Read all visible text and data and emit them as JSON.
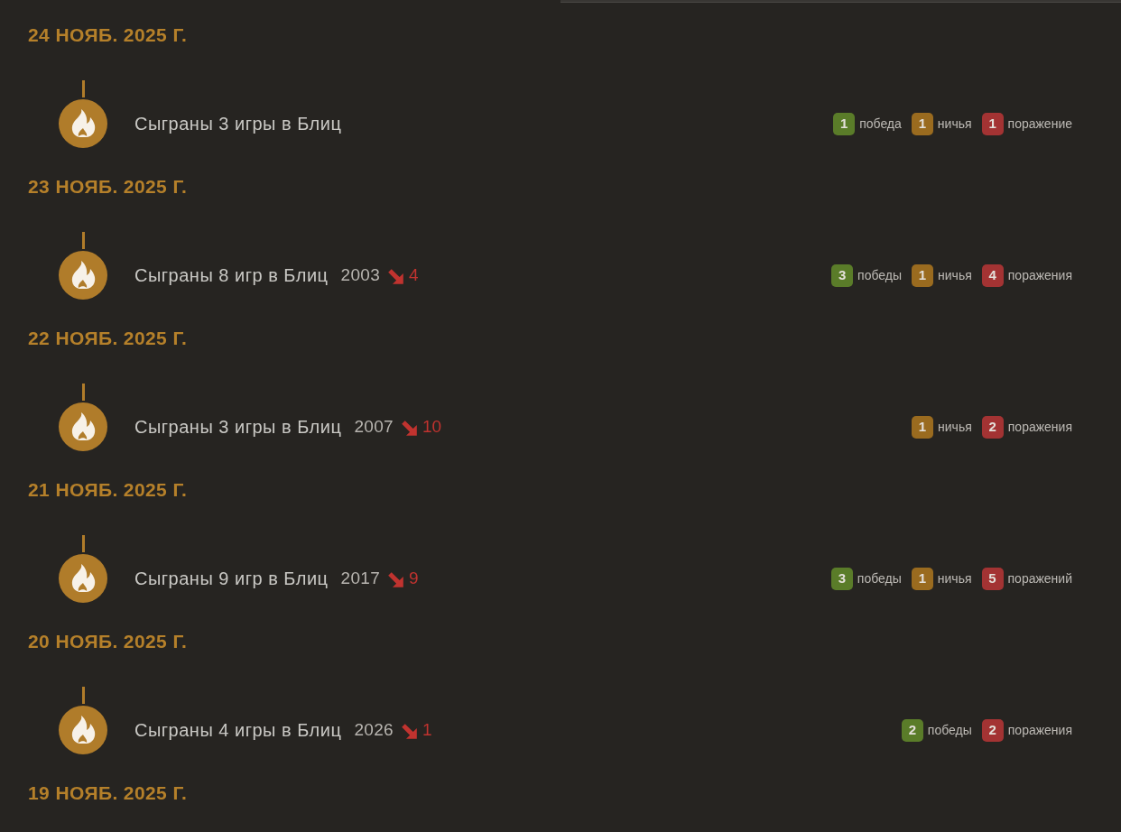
{
  "days": [
    {
      "date": "24 НОЯБ. 2025 Г.",
      "activity": {
        "title": "Сыграны 3 игры в Блиц",
        "results": [
          {
            "kind": "win",
            "count": "1",
            "label": "победа"
          },
          {
            "kind": "draw",
            "count": "1",
            "label": "ничья"
          },
          {
            "kind": "loss",
            "count": "1",
            "label": "поражение"
          }
        ]
      }
    },
    {
      "date": "23 НОЯБ. 2025 Г.",
      "activity": {
        "title": "Сыграны 8 игр в Блиц",
        "rating": "2003",
        "change": {
          "kind": "down",
          "value": "4"
        },
        "results": [
          {
            "kind": "win",
            "count": "3",
            "label": "победы"
          },
          {
            "kind": "draw",
            "count": "1",
            "label": "ничья"
          },
          {
            "kind": "loss",
            "count": "4",
            "label": "поражения"
          }
        ]
      }
    },
    {
      "date": "22 НОЯБ. 2025 Г.",
      "activity": {
        "title": "Сыграны 3 игры в Блиц",
        "rating": "2007",
        "change": {
          "kind": "down",
          "value": "10"
        },
        "results": [
          {
            "kind": "draw",
            "count": "1",
            "label": "ничья"
          },
          {
            "kind": "loss",
            "count": "2",
            "label": "поражения"
          }
        ]
      }
    },
    {
      "date": "21 НОЯБ. 2025 Г.",
      "activity": {
        "title": "Сыграны 9 игр в Блиц",
        "rating": "2017",
        "change": {
          "kind": "down",
          "value": "9"
        },
        "results": [
          {
            "kind": "win",
            "count": "3",
            "label": "победы"
          },
          {
            "kind": "draw",
            "count": "1",
            "label": "ничья"
          },
          {
            "kind": "loss",
            "count": "5",
            "label": "поражений"
          }
        ]
      }
    },
    {
      "date": "20 НОЯБ. 2025 Г.",
      "activity": {
        "title": "Сыграны 4 игры в Блиц",
        "rating": "2026",
        "change": {
          "kind": "down",
          "value": "1"
        },
        "results": [
          {
            "kind": "win",
            "count": "2",
            "label": "победы"
          },
          {
            "kind": "loss",
            "count": "2",
            "label": "поражения"
          }
        ]
      }
    },
    {
      "date": "19 НОЯБ. 2025 Г."
    }
  ]
}
